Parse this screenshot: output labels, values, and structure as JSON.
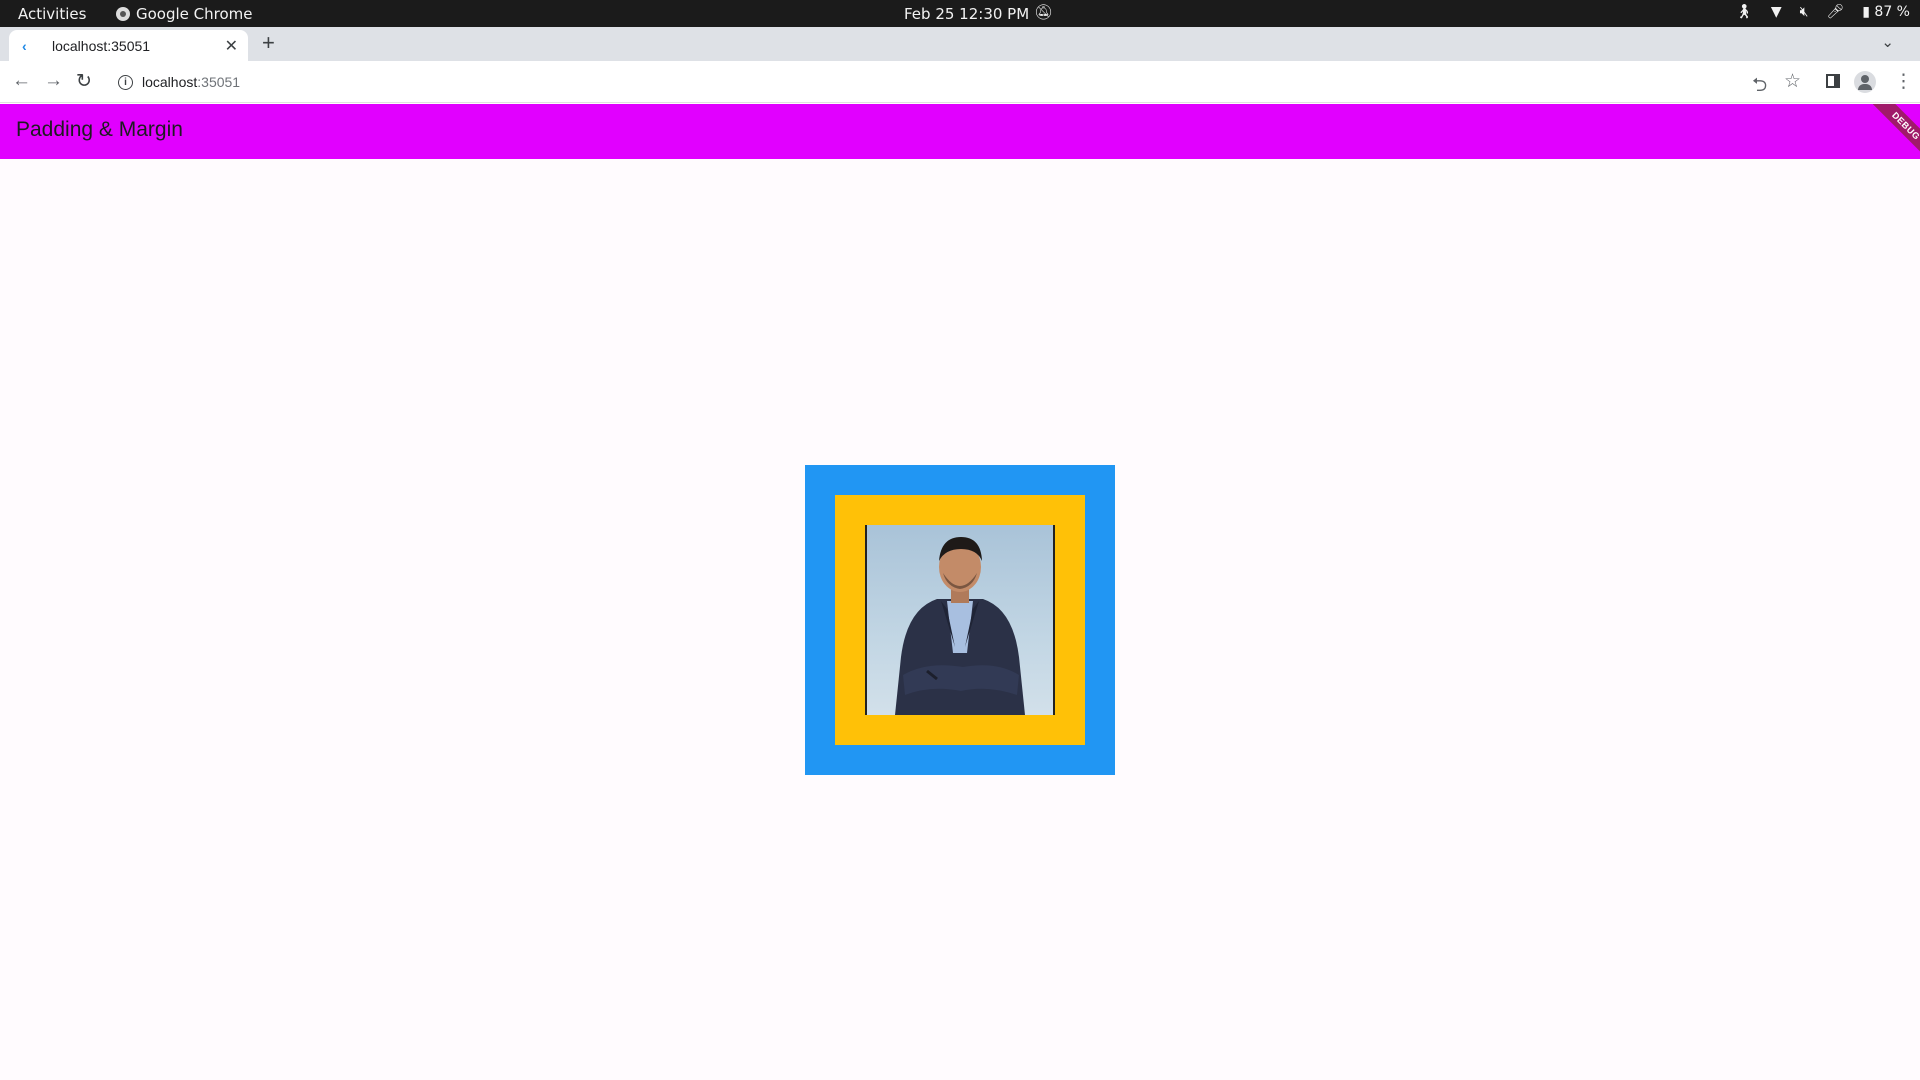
{
  "system_bar": {
    "activities": "Activities",
    "app_name": "Google Chrome",
    "clock": "Feb 25  12:30 PM",
    "battery": "87 %"
  },
  "browser": {
    "tab_title": "localhost:35051",
    "url_host": "localhost",
    "url_port": ":35051"
  },
  "app": {
    "title": "Padding & Margin",
    "debug_banner": "DEBUG",
    "colors": {
      "app_bar": "#e100ff",
      "outer_container": "#2196f3",
      "inner_container": "#ffc107",
      "background": "#fffbfe"
    }
  }
}
